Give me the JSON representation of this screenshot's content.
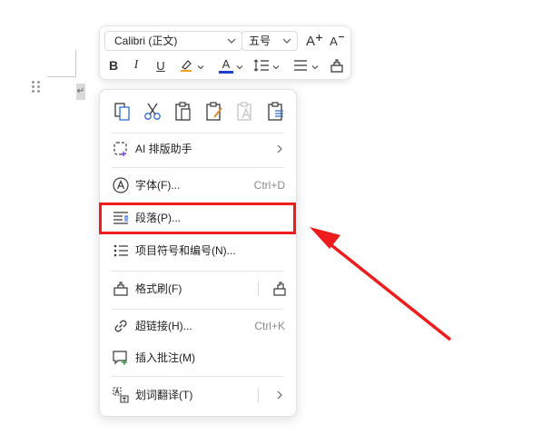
{
  "toolbar": {
    "font_name": "Calibri (正文)",
    "font_size": "五号",
    "grow_font_label": "A",
    "shrink_font_label": "A",
    "bold_label": "B",
    "italic_label": "I",
    "underline_label": "U",
    "font_color_label": "A",
    "font_color": "#1a3fd1"
  },
  "menu": {
    "ai_assistant": {
      "label": "AI 排版助手"
    },
    "font": {
      "label": "字体(F)...",
      "shortcut": "Ctrl+D"
    },
    "paragraph": {
      "label": "段落(P)..."
    },
    "bullets": {
      "label": "项目符号和编号(N)..."
    },
    "format_painter": {
      "label": "格式刷(F)"
    },
    "hyperlink": {
      "label": "超链接(H)...",
      "shortcut": "Ctrl+K"
    },
    "comment": {
      "label": "插入批注(M)"
    },
    "translate": {
      "label": "划词翻译(T)"
    }
  },
  "colors": {
    "highlight": "#ee1c1c",
    "icon": "#3a3a3a",
    "ai_accent": "#7a4cf0"
  },
  "doc": {
    "paragraph_mark": "↵"
  }
}
